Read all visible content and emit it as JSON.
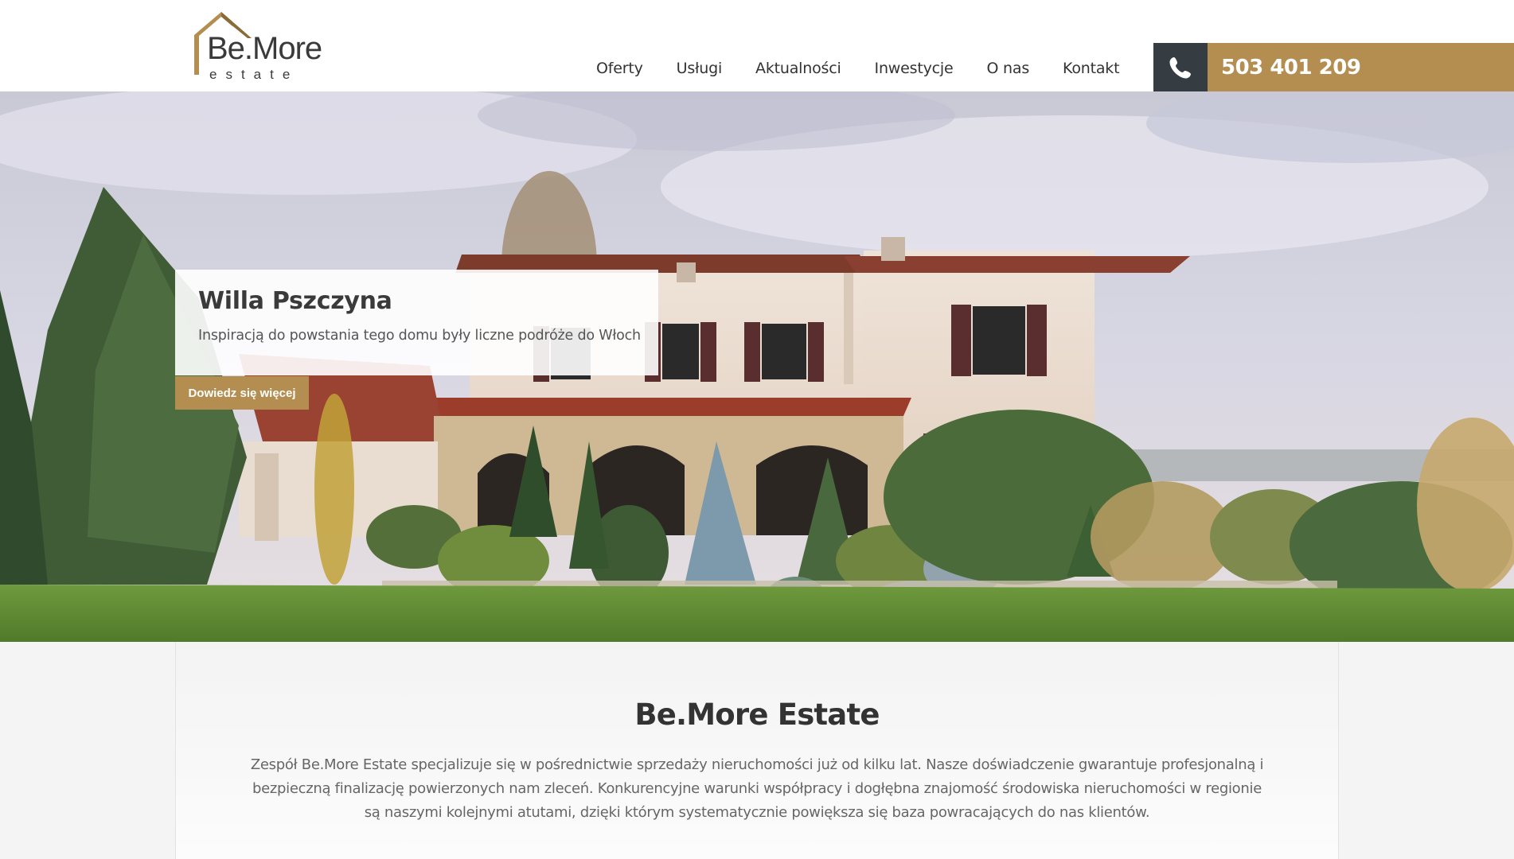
{
  "header": {
    "logo": {
      "brand": "Be.More",
      "sub": "estate"
    },
    "nav": [
      {
        "label": "Oferty"
      },
      {
        "label": "Usługi"
      },
      {
        "label": "Aktualności"
      },
      {
        "label": "Inwestycje"
      },
      {
        "label": "O nas"
      },
      {
        "label": "Kontakt"
      }
    ],
    "favorites_icon": "heart-icon",
    "phone_icon": "phone-icon",
    "phone": "503 401 209"
  },
  "hero": {
    "title": "Willa Pszczyna",
    "subtitle": "Inspiracją do powstania tego domu były liczne podróże do Włoch",
    "button": "Dowiedz się więcej"
  },
  "about": {
    "title": "Be.More Estate",
    "text": "Zespół Be.More Estate specjalizuje się w pośrednictwie sprzedaży nieruchomości już od kilku lat. Nasze doświadczenie gwarantuje profesjonalną i bezpieczną finalizację powierzonych nam zleceń. Konkurencyjne warunki współpracy i dogłębna znajomość środowiska nieruchomości w regionie są naszymi kolejnymi atutami, dzięki którym systematycznie powiększa się baza powracających do nas klientów."
  },
  "colors": {
    "accent": "#b48e50",
    "dark": "#353c42"
  }
}
